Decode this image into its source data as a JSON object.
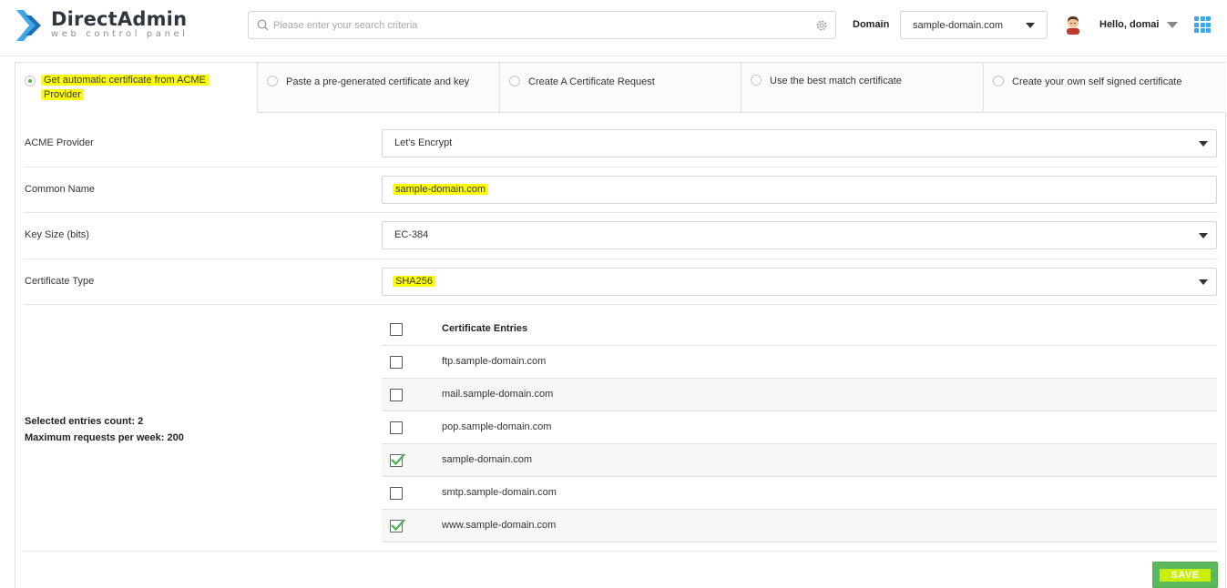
{
  "header": {
    "logo_title": "DirectAdmin",
    "logo_subtitle": "web control panel",
    "search_placeholder": "Please enter your search criteria",
    "domain_label": "Domain",
    "domain_value": "sample-domain.com",
    "greeting": "Hello, domai"
  },
  "tabs": [
    {
      "label": "Get automatic certificate from ACME Provider",
      "active": true
    },
    {
      "label": "Paste a pre-generated certificate and key",
      "active": false
    },
    {
      "label": "Create A Certificate Request",
      "active": false
    },
    {
      "label": "Use the best match certificate",
      "active": false
    },
    {
      "label": "Create your own self signed certificate",
      "active": false
    }
  ],
  "form": {
    "acme_provider": {
      "label": "ACME Provider",
      "value": "Let's Encrypt"
    },
    "common_name": {
      "label": "Common Name",
      "value": "sample-domain.com"
    },
    "key_size": {
      "label": "Key Size (bits)",
      "value": "EC-384"
    },
    "certificate_type": {
      "label": "Certificate Type",
      "value": "SHA256"
    }
  },
  "entries": {
    "selected_count_text": "Selected entries count: 2",
    "max_requests_text": "Maximum requests per week: 200",
    "header": "Certificate Entries",
    "rows": [
      {
        "name": "ftp.sample-domain.com",
        "checked": false
      },
      {
        "name": "mail.sample-domain.com",
        "checked": false
      },
      {
        "name": "pop.sample-domain.com",
        "checked": false
      },
      {
        "name": "sample-domain.com",
        "checked": true
      },
      {
        "name": "smtp.sample-domain.com",
        "checked": false
      },
      {
        "name": "www.sample-domain.com",
        "checked": true
      }
    ]
  },
  "save_label": "SAVE",
  "colors": {
    "brand_blue": "#3fa6e8",
    "save_green": "#5cb85c",
    "highlight": "#ffff00",
    "check_green": "#4caf50"
  },
  "icons": [
    "logo-icon",
    "search-icon",
    "gear-icon",
    "chevron-down-icon",
    "avatar",
    "apps-grid-icon",
    "checkmark-icon"
  ]
}
